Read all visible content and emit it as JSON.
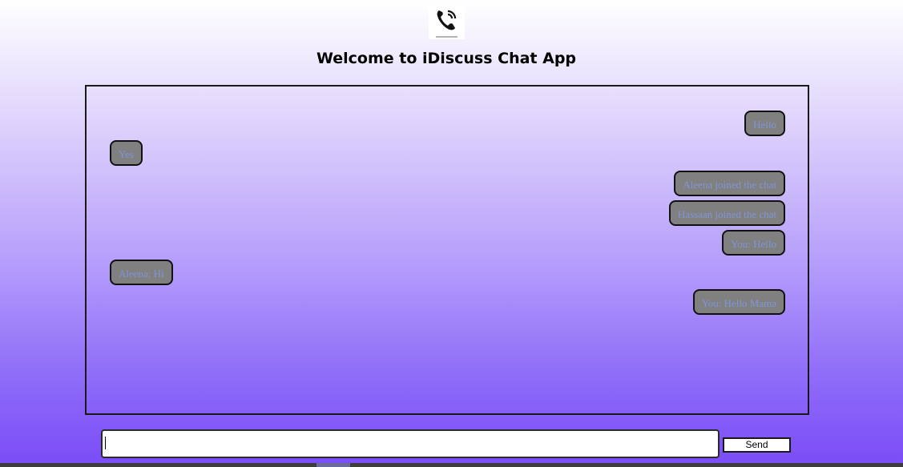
{
  "header": {
    "title": "Welcome to iDiscuss Chat App",
    "logo_icon": "phone-icon"
  },
  "chat": {
    "messages": [
      {
        "text": "Hello",
        "side": "right"
      },
      {
        "text": "Yes",
        "side": "left"
      },
      {
        "text": "Aleena joined the chat",
        "side": "right"
      },
      {
        "text": "Hassaan joined the chat",
        "side": "right"
      },
      {
        "text": "You: Hello",
        "side": "right"
      },
      {
        "text": "Aleena: Hi",
        "side": "left"
      },
      {
        "text": "You: Hello Mama",
        "side": "right"
      }
    ]
  },
  "composer": {
    "value": "",
    "send_label": "Send"
  },
  "colors": {
    "bubble_bg": "#808080",
    "bubble_text": "#7f95d8",
    "bubble_border": "#111111",
    "gradient_top": "#ffffff",
    "gradient_bottom": "#7a4cf7"
  }
}
